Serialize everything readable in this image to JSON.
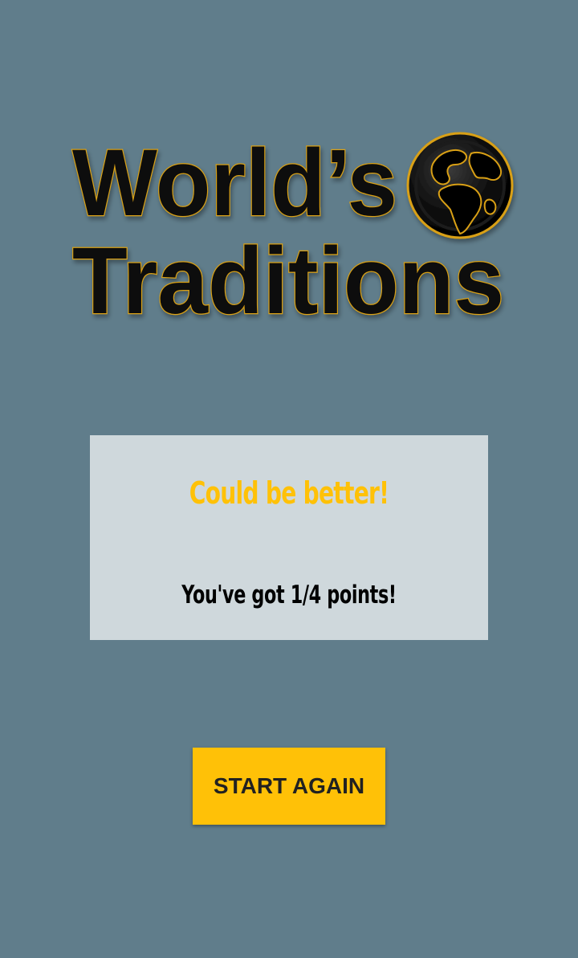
{
  "app": {
    "logo": {
      "line1": "World’s",
      "line2": "Traditions",
      "icon": "globe-icon"
    }
  },
  "result": {
    "title": "Could be better!",
    "score_text": "You've got 1/4 points!"
  },
  "actions": {
    "start_again_label": "START AGAIN"
  },
  "colors": {
    "background": "#607d8b",
    "card": "#cfd8dc",
    "accent": "#ffc107",
    "logo_outline": "#d9a012"
  }
}
